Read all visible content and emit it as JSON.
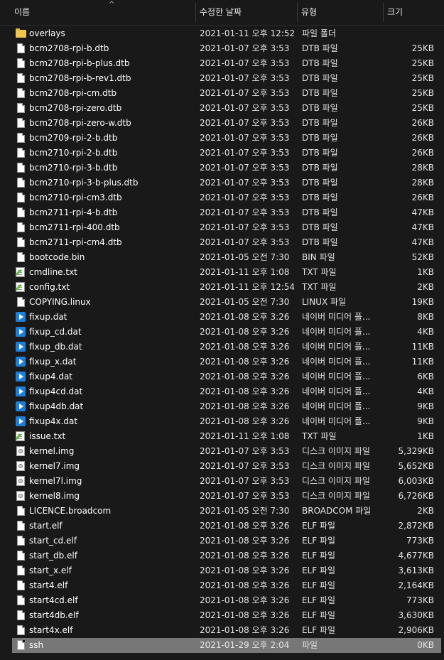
{
  "columns": {
    "name": "이름",
    "date": "수정한 날짜",
    "type": "유형",
    "size": "크기",
    "sort_indicator": "^"
  },
  "files": [
    {
      "name": "overlays",
      "date": "2021-01-11 오후 12:52",
      "type": "파일 폴더",
      "size": "",
      "icon": "folder-icon"
    },
    {
      "name": "bcm2708-rpi-b.dtb",
      "date": "2021-01-07 오후 3:53",
      "type": "DTB 파일",
      "size": "25KB",
      "icon": "file-icon"
    },
    {
      "name": "bcm2708-rpi-b-plus.dtb",
      "date": "2021-01-07 오후 3:53",
      "type": "DTB 파일",
      "size": "25KB",
      "icon": "file-icon"
    },
    {
      "name": "bcm2708-rpi-b-rev1.dtb",
      "date": "2021-01-07 오후 3:53",
      "type": "DTB 파일",
      "size": "25KB",
      "icon": "file-icon"
    },
    {
      "name": "bcm2708-rpi-cm.dtb",
      "date": "2021-01-07 오후 3:53",
      "type": "DTB 파일",
      "size": "25KB",
      "icon": "file-icon"
    },
    {
      "name": "bcm2708-rpi-zero.dtb",
      "date": "2021-01-07 오후 3:53",
      "type": "DTB 파일",
      "size": "25KB",
      "icon": "file-icon"
    },
    {
      "name": "bcm2708-rpi-zero-w.dtb",
      "date": "2021-01-07 오후 3:53",
      "type": "DTB 파일",
      "size": "26KB",
      "icon": "file-icon"
    },
    {
      "name": "bcm2709-rpi-2-b.dtb",
      "date": "2021-01-07 오후 3:53",
      "type": "DTB 파일",
      "size": "26KB",
      "icon": "file-icon"
    },
    {
      "name": "bcm2710-rpi-2-b.dtb",
      "date": "2021-01-07 오후 3:53",
      "type": "DTB 파일",
      "size": "26KB",
      "icon": "file-icon"
    },
    {
      "name": "bcm2710-rpi-3-b.dtb",
      "date": "2021-01-07 오후 3:53",
      "type": "DTB 파일",
      "size": "28KB",
      "icon": "file-icon"
    },
    {
      "name": "bcm2710-rpi-3-b-plus.dtb",
      "date": "2021-01-07 오후 3:53",
      "type": "DTB 파일",
      "size": "28KB",
      "icon": "file-icon"
    },
    {
      "name": "bcm2710-rpi-cm3.dtb",
      "date": "2021-01-07 오후 3:53",
      "type": "DTB 파일",
      "size": "26KB",
      "icon": "file-icon"
    },
    {
      "name": "bcm2711-rpi-4-b.dtb",
      "date": "2021-01-07 오후 3:53",
      "type": "DTB 파일",
      "size": "47KB",
      "icon": "file-icon"
    },
    {
      "name": "bcm2711-rpi-400.dtb",
      "date": "2021-01-07 오후 3:53",
      "type": "DTB 파일",
      "size": "47KB",
      "icon": "file-icon"
    },
    {
      "name": "bcm2711-rpi-cm4.dtb",
      "date": "2021-01-07 오후 3:53",
      "type": "DTB 파일",
      "size": "47KB",
      "icon": "file-icon"
    },
    {
      "name": "bootcode.bin",
      "date": "2021-01-05 오전 7:30",
      "type": "BIN 파일",
      "size": "52KB",
      "icon": "file-icon"
    },
    {
      "name": "cmdline.txt",
      "date": "2021-01-11 오후 1:08",
      "type": "TXT 파일",
      "size": "1KB",
      "icon": "text-file-icon"
    },
    {
      "name": "config.txt",
      "date": "2021-01-11 오후 12:54",
      "type": "TXT 파일",
      "size": "2KB",
      "icon": "text-file-icon"
    },
    {
      "name": "COPYING.linux",
      "date": "2021-01-05 오전 7:30",
      "type": "LINUX 파일",
      "size": "19KB",
      "icon": "file-icon"
    },
    {
      "name": "fixup.dat",
      "date": "2021-01-08 오후 3:26",
      "type": "네이버 미디어 플...",
      "size": "8KB",
      "icon": "media-file-icon"
    },
    {
      "name": "fixup_cd.dat",
      "date": "2021-01-08 오후 3:26",
      "type": "네이버 미디어 플...",
      "size": "4KB",
      "icon": "media-file-icon"
    },
    {
      "name": "fixup_db.dat",
      "date": "2021-01-08 오후 3:26",
      "type": "네이버 미디어 플...",
      "size": "11KB",
      "icon": "media-file-icon"
    },
    {
      "name": "fixup_x.dat",
      "date": "2021-01-08 오후 3:26",
      "type": "네이버 미디어 플...",
      "size": "11KB",
      "icon": "media-file-icon"
    },
    {
      "name": "fixup4.dat",
      "date": "2021-01-08 오후 3:26",
      "type": "네이버 미디어 플...",
      "size": "6KB",
      "icon": "media-file-icon"
    },
    {
      "name": "fixup4cd.dat",
      "date": "2021-01-08 오후 3:26",
      "type": "네이버 미디어 플...",
      "size": "4KB",
      "icon": "media-file-icon"
    },
    {
      "name": "fixup4db.dat",
      "date": "2021-01-08 오후 3:26",
      "type": "네이버 미디어 플...",
      "size": "9KB",
      "icon": "media-file-icon"
    },
    {
      "name": "fixup4x.dat",
      "date": "2021-01-08 오후 3:26",
      "type": "네이버 미디어 플...",
      "size": "9KB",
      "icon": "media-file-icon"
    },
    {
      "name": "issue.txt",
      "date": "2021-01-11 오후 1:08",
      "type": "TXT 파일",
      "size": "1KB",
      "icon": "text-file-icon"
    },
    {
      "name": "kernel.img",
      "date": "2021-01-07 오후 3:53",
      "type": "디스크 이미지 파일",
      "size": "5,329KB",
      "icon": "disk-image-icon"
    },
    {
      "name": "kernel7.img",
      "date": "2021-01-07 오후 3:53",
      "type": "디스크 이미지 파일",
      "size": "5,652KB",
      "icon": "disk-image-icon"
    },
    {
      "name": "kernel7l.img",
      "date": "2021-01-07 오후 3:53",
      "type": "디스크 이미지 파일",
      "size": "6,003KB",
      "icon": "disk-image-icon"
    },
    {
      "name": "kernel8.img",
      "date": "2021-01-07 오후 3:53",
      "type": "디스크 이미지 파일",
      "size": "6,726KB",
      "icon": "disk-image-icon"
    },
    {
      "name": "LICENCE.broadcom",
      "date": "2021-01-05 오전 7:30",
      "type": "BROADCOM 파일",
      "size": "2KB",
      "icon": "file-icon"
    },
    {
      "name": "start.elf",
      "date": "2021-01-08 오후 3:26",
      "type": "ELF 파일",
      "size": "2,872KB",
      "icon": "file-icon"
    },
    {
      "name": "start_cd.elf",
      "date": "2021-01-08 오후 3:26",
      "type": "ELF 파일",
      "size": "773KB",
      "icon": "file-icon"
    },
    {
      "name": "start_db.elf",
      "date": "2021-01-08 오후 3:26",
      "type": "ELF 파일",
      "size": "4,677KB",
      "icon": "file-icon"
    },
    {
      "name": "start_x.elf",
      "date": "2021-01-08 오후 3:26",
      "type": "ELF 파일",
      "size": "3,613KB",
      "icon": "file-icon"
    },
    {
      "name": "start4.elf",
      "date": "2021-01-08 오후 3:26",
      "type": "ELF 파일",
      "size": "2,164KB",
      "icon": "file-icon"
    },
    {
      "name": "start4cd.elf",
      "date": "2021-01-08 오후 3:26",
      "type": "ELF 파일",
      "size": "773KB",
      "icon": "file-icon"
    },
    {
      "name": "start4db.elf",
      "date": "2021-01-08 오후 3:26",
      "type": "ELF 파일",
      "size": "3,630KB",
      "icon": "file-icon"
    },
    {
      "name": "start4x.elf",
      "date": "2021-01-08 오후 3:26",
      "type": "ELF 파일",
      "size": "2,906KB",
      "icon": "file-icon"
    },
    {
      "name": "ssh",
      "date": "2021-01-29 오후 2:04",
      "type": "파일",
      "size": "0KB",
      "icon": "file-icon",
      "selected": true
    }
  ],
  "colors": {
    "background": "#191919",
    "text": "#ffffff",
    "selection": "#777777",
    "folder": "#f2c54b",
    "media": "#1f7fd6"
  }
}
